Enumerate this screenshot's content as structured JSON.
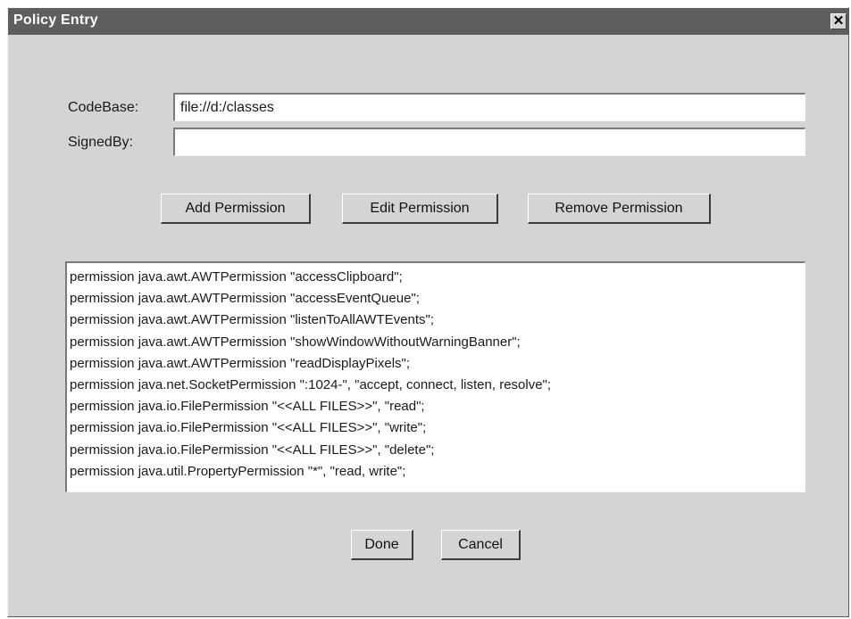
{
  "window": {
    "title": "Policy Entry",
    "close_glyph": "✕"
  },
  "form": {
    "codebase_label": "CodeBase:",
    "codebase_value": "file://d:/classes",
    "signedby_label": "SignedBy:",
    "signedby_value": ""
  },
  "actions": {
    "add": "Add Permission",
    "edit": "Edit Permission",
    "remove": "Remove Permission"
  },
  "permissions": [
    "permission java.awt.AWTPermission \"accessClipboard\";",
    "permission java.awt.AWTPermission \"accessEventQueue\";",
    "permission java.awt.AWTPermission \"listenToAllAWTEvents\";",
    "permission java.awt.AWTPermission \"showWindowWithoutWarningBanner\";",
    "permission java.awt.AWTPermission \"readDisplayPixels\";",
    "permission java.net.SocketPermission \":1024-\", \"accept, connect, listen, resolve\";",
    "permission java.io.FilePermission \"<<ALL FILES>>\", \"read\";",
    "permission java.io.FilePermission \"<<ALL FILES>>\", \"write\";",
    "permission java.io.FilePermission \"<<ALL FILES>>\", \"delete\";",
    "permission java.util.PropertyPermission \"*\", \"read, write\";"
  ],
  "footer": {
    "done": "Done",
    "cancel": "Cancel"
  }
}
